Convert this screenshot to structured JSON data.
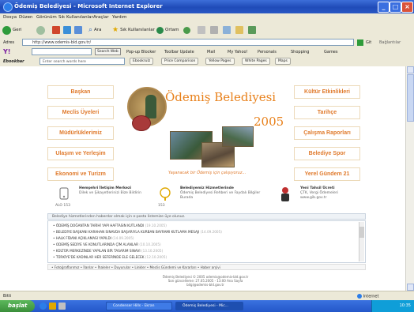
{
  "window": {
    "title": "Ödemiş Belediyesi - Microsoft Internet Explorer"
  },
  "menu": [
    "Dosya",
    "Düzen",
    "Görünüm",
    "Sık Kullanılanlar",
    "Araçlar",
    "Yardım"
  ],
  "toolbar": {
    "back": "Geri",
    "search": "Ara",
    "favorites": "Sık Kullanılanlar",
    "media": "Ortam"
  },
  "address": {
    "label": "Adres",
    "url": "http://www.odemis-bld.gov.tr/",
    "go": "Git",
    "links": "Bağlantılar"
  },
  "toolbar2": {
    "search_web": "Search Web",
    "popup_blocker": "Pop-up Blocker",
    "toolbar_update": "Toolbar Update",
    "mail": "Mail",
    "my_yahoo": "My Yahoo!",
    "personals": "Personals",
    "shopping": "Shopping",
    "games": "Games"
  },
  "toolbar3": {
    "brand": "Ebookbar",
    "search_placeholder": "Enter search words here",
    "tabs": [
      "Ebookrulz",
      "Price Comparison",
      "Yellow Pages",
      "White Pages",
      "Maps"
    ]
  },
  "page": {
    "nav_left": [
      "Başkan",
      "Meclis Üyeleri",
      "Müdürlüklerimiz",
      "Ulaşım ve Yerleşim",
      "Ekonomi ve Turizm"
    ],
    "nav_right": [
      "Kültür Etkinlikleri",
      "Tarihçe",
      "Çalışma Raporları",
      "Belediye Spor",
      "Yerel Gündem 21"
    ],
    "brand_title": "Ödemiş Belediyesi",
    "brand_year": "2005",
    "tagline": "Yaşanacak bir Ödemiş için çalışıyoruz...",
    "services": [
      {
        "title": "Hemşehri İletişim Merkezi",
        "desc": "Dilek ve Şikayetlerinizi Bize Bildirin",
        "code": "ALO 153"
      },
      {
        "title": "Belediyemiz Hizmetlerinde",
        "desc": "Ödemiş Belediyesi Rehberi ve Faydalı Bilgiler Burada",
        "code": "153"
      },
      {
        "title": "Yeni Tahsil Ücreti",
        "desc": "ÇTK, Vergi Ödemeleri",
        "code": "www.gib.gov.tr"
      }
    ],
    "notice": "Belediye hizmetlerinden haberdar olmak için e-posta listemize üye olunuz.",
    "news": [
      {
        "text": "ÖDEMİŞ DOĞANTAN TARİHİ YAPI HAFTASIN KUTLANDI",
        "date": "(19.10.2005)"
      },
      {
        "text": "BELEDİYE BAŞKANI KARAHAN SINAVDA BAŞARIYLA KURBAN BAYRAMI KUTLAMA MESAJI",
        "date": "(14.09.2005)"
      },
      {
        "text": "HALK FİDANI AÇIKLAMASI YAPILDI",
        "date": "(14.09.2005)"
      },
      {
        "text": "ODEMİŞ SEDİYE VE KONUTLARINDA ÇİM ALANLAR",
        "date": "(10.10.2005)"
      },
      {
        "text": "KÜLTÜR MERKEZİNDE YAPILAN BİR TASARIM SINAVI",
        "date": "(13.10.2005)"
      },
      {
        "text": "TÜRKİYE'DE KADINLAR HER SEFERİNDE ELE GELECEK",
        "date": "(12.10.2005)"
      }
    ],
    "links_bar": "• Fotoğraflarımız • İlanlar • İhaleler • Duyurular • Linkler • Meclis Gündemi ve Kararları • Haber arşivi",
    "footer": [
      "Ödemiş Belediyesi © 2005 odemis@odemis-bld.gov.tr",
      "Son güncelleme: 27.05.2005 - 13:00 Ana Sayfa",
      "bilgi@odemis-bld.gov.tr"
    ]
  },
  "status": {
    "left": "Bitti",
    "zone": "Internet"
  },
  "taskbar": {
    "start": "başlat",
    "items": [
      "Condenser Hills - Ekran",
      "Ödemiş Belediyesi - Mic..."
    ],
    "clock": "10:35"
  },
  "colors": {
    "accent": "#e07a2c",
    "chrome": "#ece9d8",
    "titlebar": "#1f4bb8"
  }
}
